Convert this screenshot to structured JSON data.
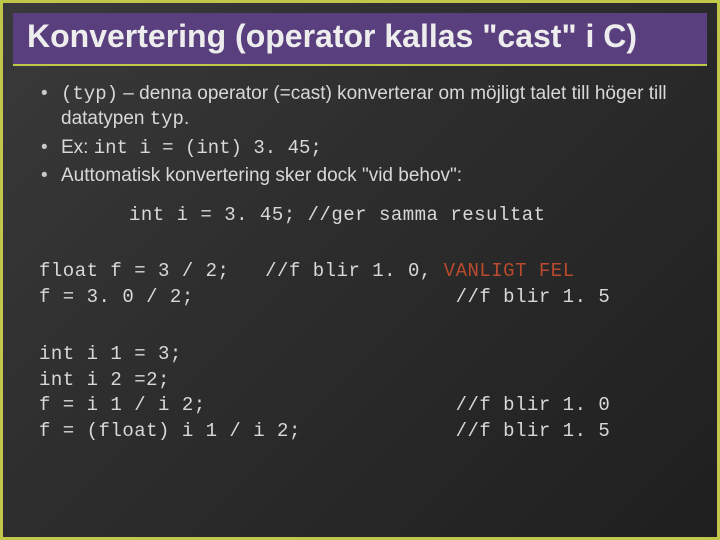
{
  "title": "Konvertering (operator kallas \"cast\" i C)",
  "bullets": {
    "b1_code": "(typ)",
    "b1_text_after": " – denna operator (=cast) konverterar om möjligt talet till höger till datatypen ",
    "b1_code2": "typ",
    "b1_period": ".",
    "b2_prefix": "  Ex: ",
    "b2_code": "int i = (int) 3. 45;",
    "b3_text": "Auttomatisk konvertering sker dock \"vid behov\":",
    "b3_code_line": "int i = 3. 45; //ger samma resultat"
  },
  "code1": {
    "line1_left": "float f = 3 / 2;   ",
    "line1_comment_plain": "//f blir 1. 0, ",
    "line1_comment_red": "VANLIGT FEL",
    "line2": "f = 3. 0 / 2;                      //f blir 1. 5"
  },
  "code2": {
    "l1": "int i 1 = 3;",
    "l2": "int i 2 =2;",
    "l3": "f = i 1 / i 2;                     //f blir 1. 0",
    "l4": "f = (float) i 1 / i 2;             //f blir 1. 5"
  }
}
